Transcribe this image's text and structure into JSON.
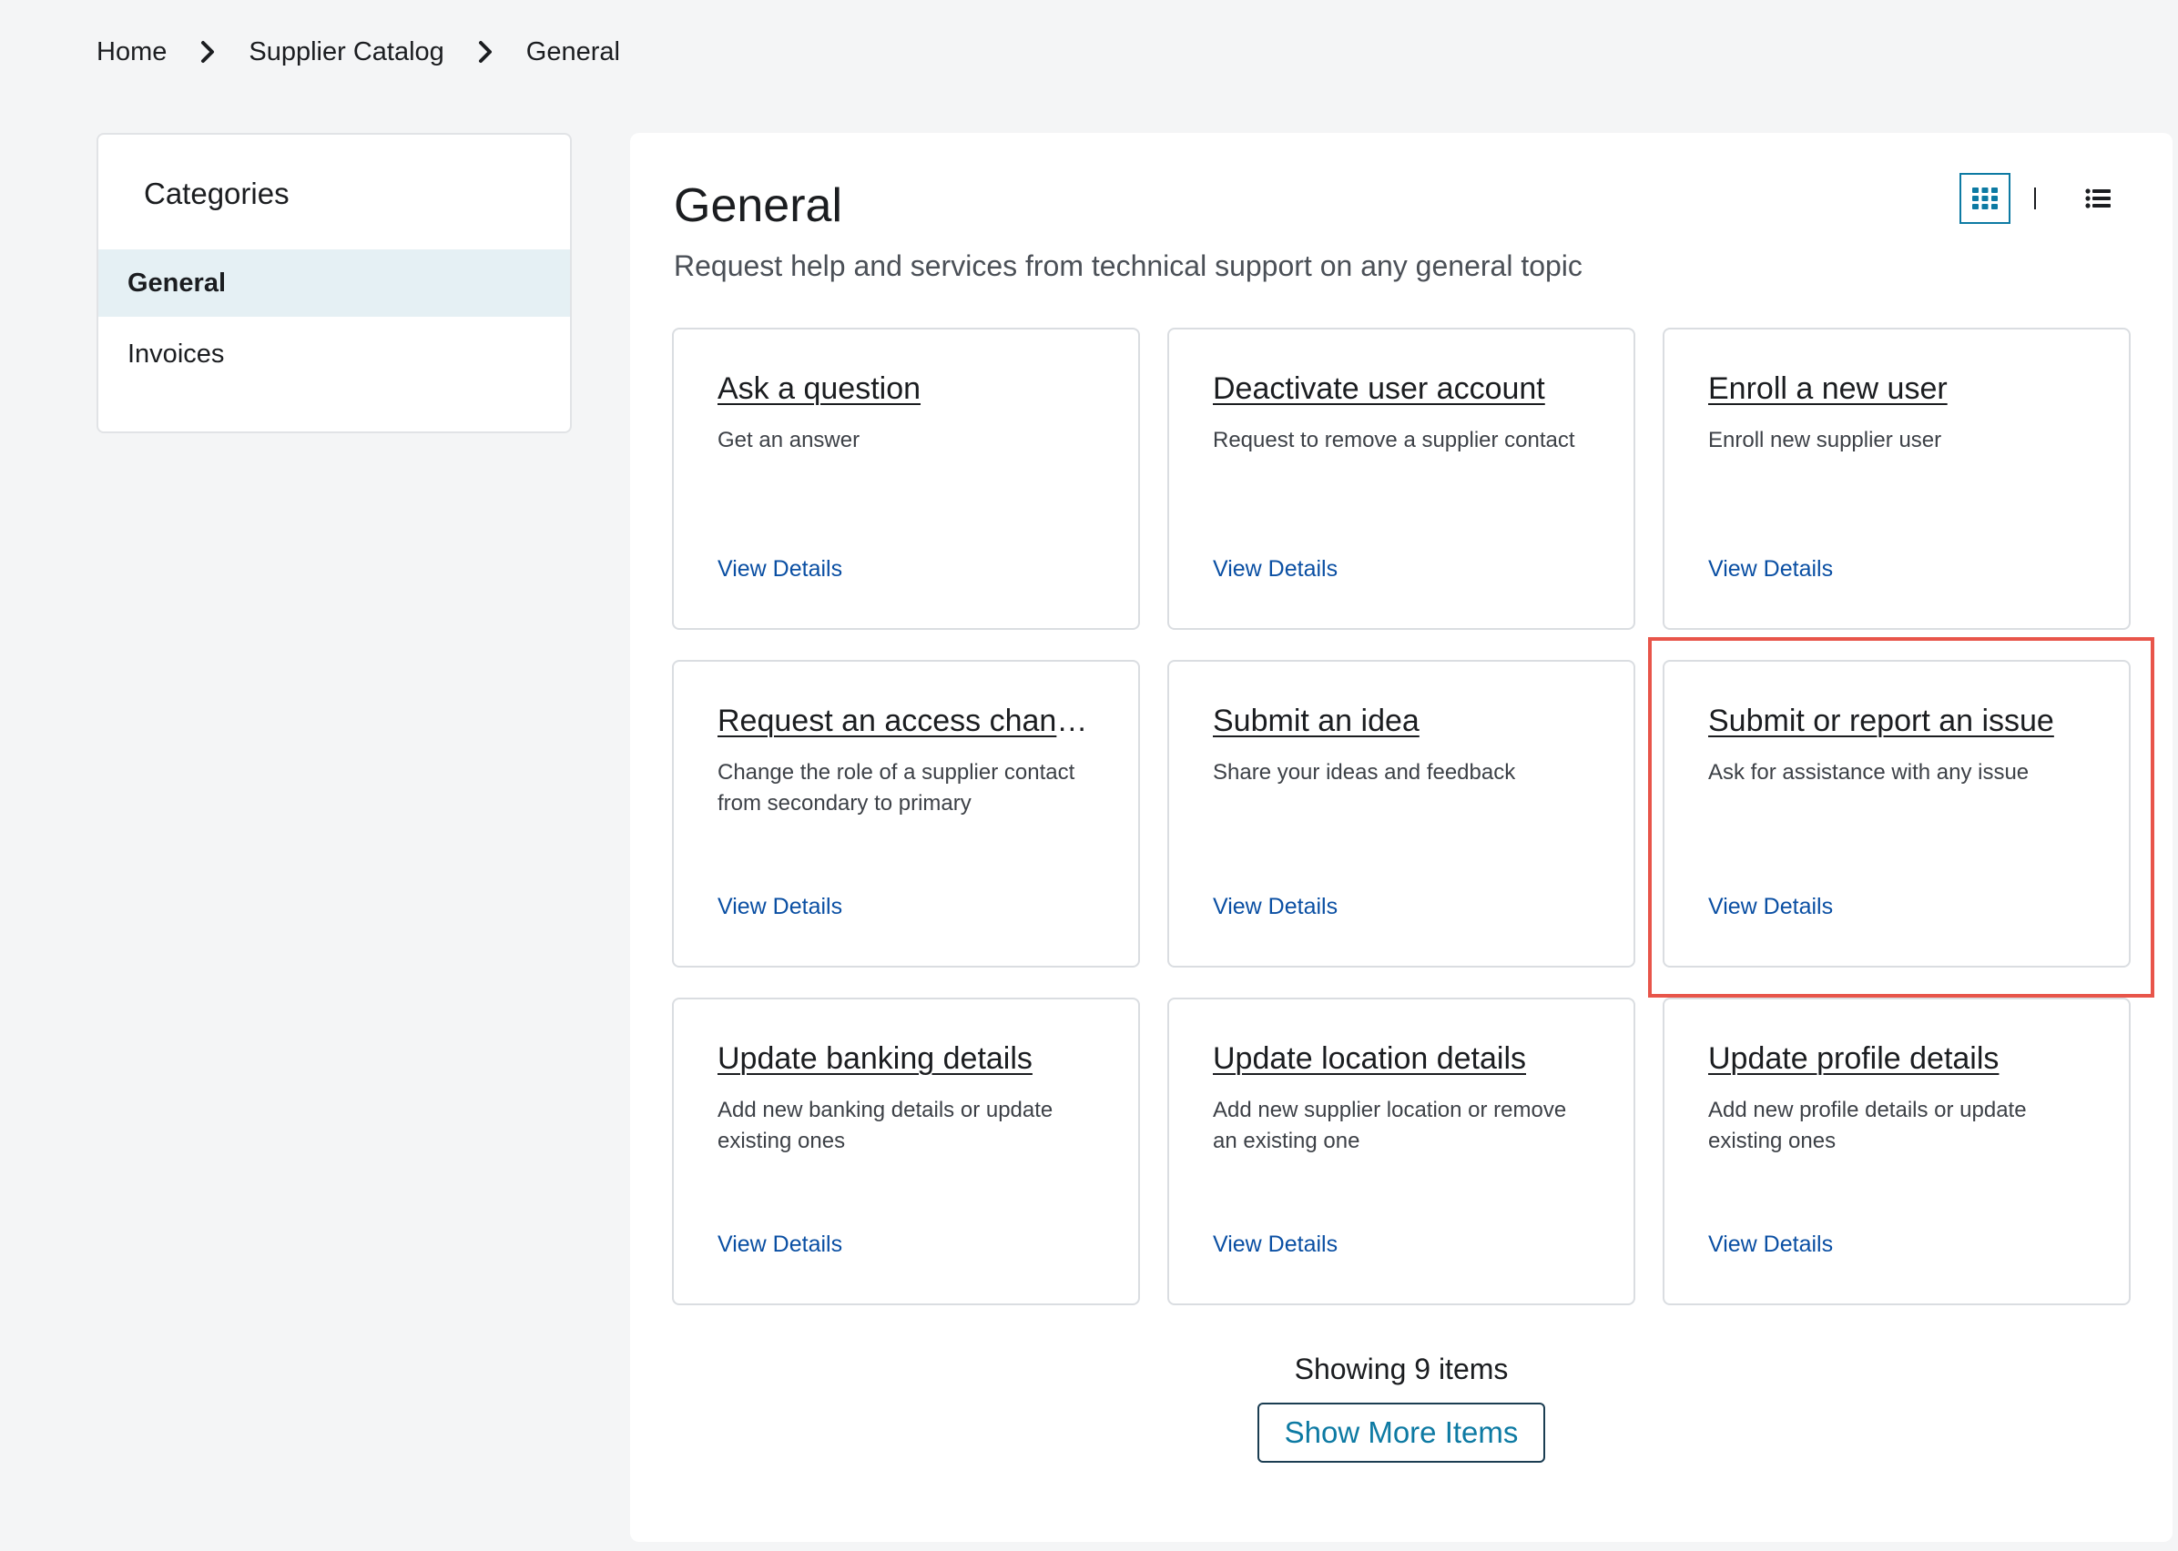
{
  "breadcrumb": {
    "items": [
      "Home",
      "Supplier Catalog",
      "General"
    ]
  },
  "sidebar": {
    "heading": "Categories",
    "items": [
      {
        "label": "General",
        "active": true
      },
      {
        "label": "Invoices",
        "active": false
      }
    ]
  },
  "main": {
    "title": "General",
    "subtitle": "Request help and services from technical support on any general topic",
    "view_toggle": {
      "active": "grid",
      "icons": [
        "grid-view-icon",
        "list-view-icon"
      ]
    },
    "cards": [
      {
        "title": "Ask a question",
        "description": "Get an answer",
        "link": "View Details"
      },
      {
        "title": "Deactivate user account",
        "description": "Request to remove a supplier contact",
        "link": "View Details"
      },
      {
        "title": "Enroll a new user",
        "description": "Enroll new supplier user",
        "link": "View Details"
      },
      {
        "title": "Request an access change r...",
        "description": "Change the role of a supplier contact from secondary to primary",
        "link": "View Details"
      },
      {
        "title": "Submit an idea",
        "description": "Share your ideas and feedback",
        "link": "View Details"
      },
      {
        "title": "Submit or report an issue",
        "description": "Ask for assistance with any issue",
        "link": "View Details"
      },
      {
        "title": "Update banking details",
        "description": "Add new banking details or update existing ones",
        "link": "View Details"
      },
      {
        "title": "Update location details",
        "description": "Add new supplier location or remove an existing one",
        "link": "View Details"
      },
      {
        "title": "Update profile details",
        "description": "Add new profile details or update existing ones",
        "link": "View Details"
      }
    ],
    "count_text": "Showing 9 items",
    "show_more_label": "Show More Items"
  },
  "colors": {
    "accent": "#0d7aa3",
    "link": "#0a4fa3",
    "highlight": "#e8554a",
    "active_category_bg": "#e5f0f4"
  }
}
